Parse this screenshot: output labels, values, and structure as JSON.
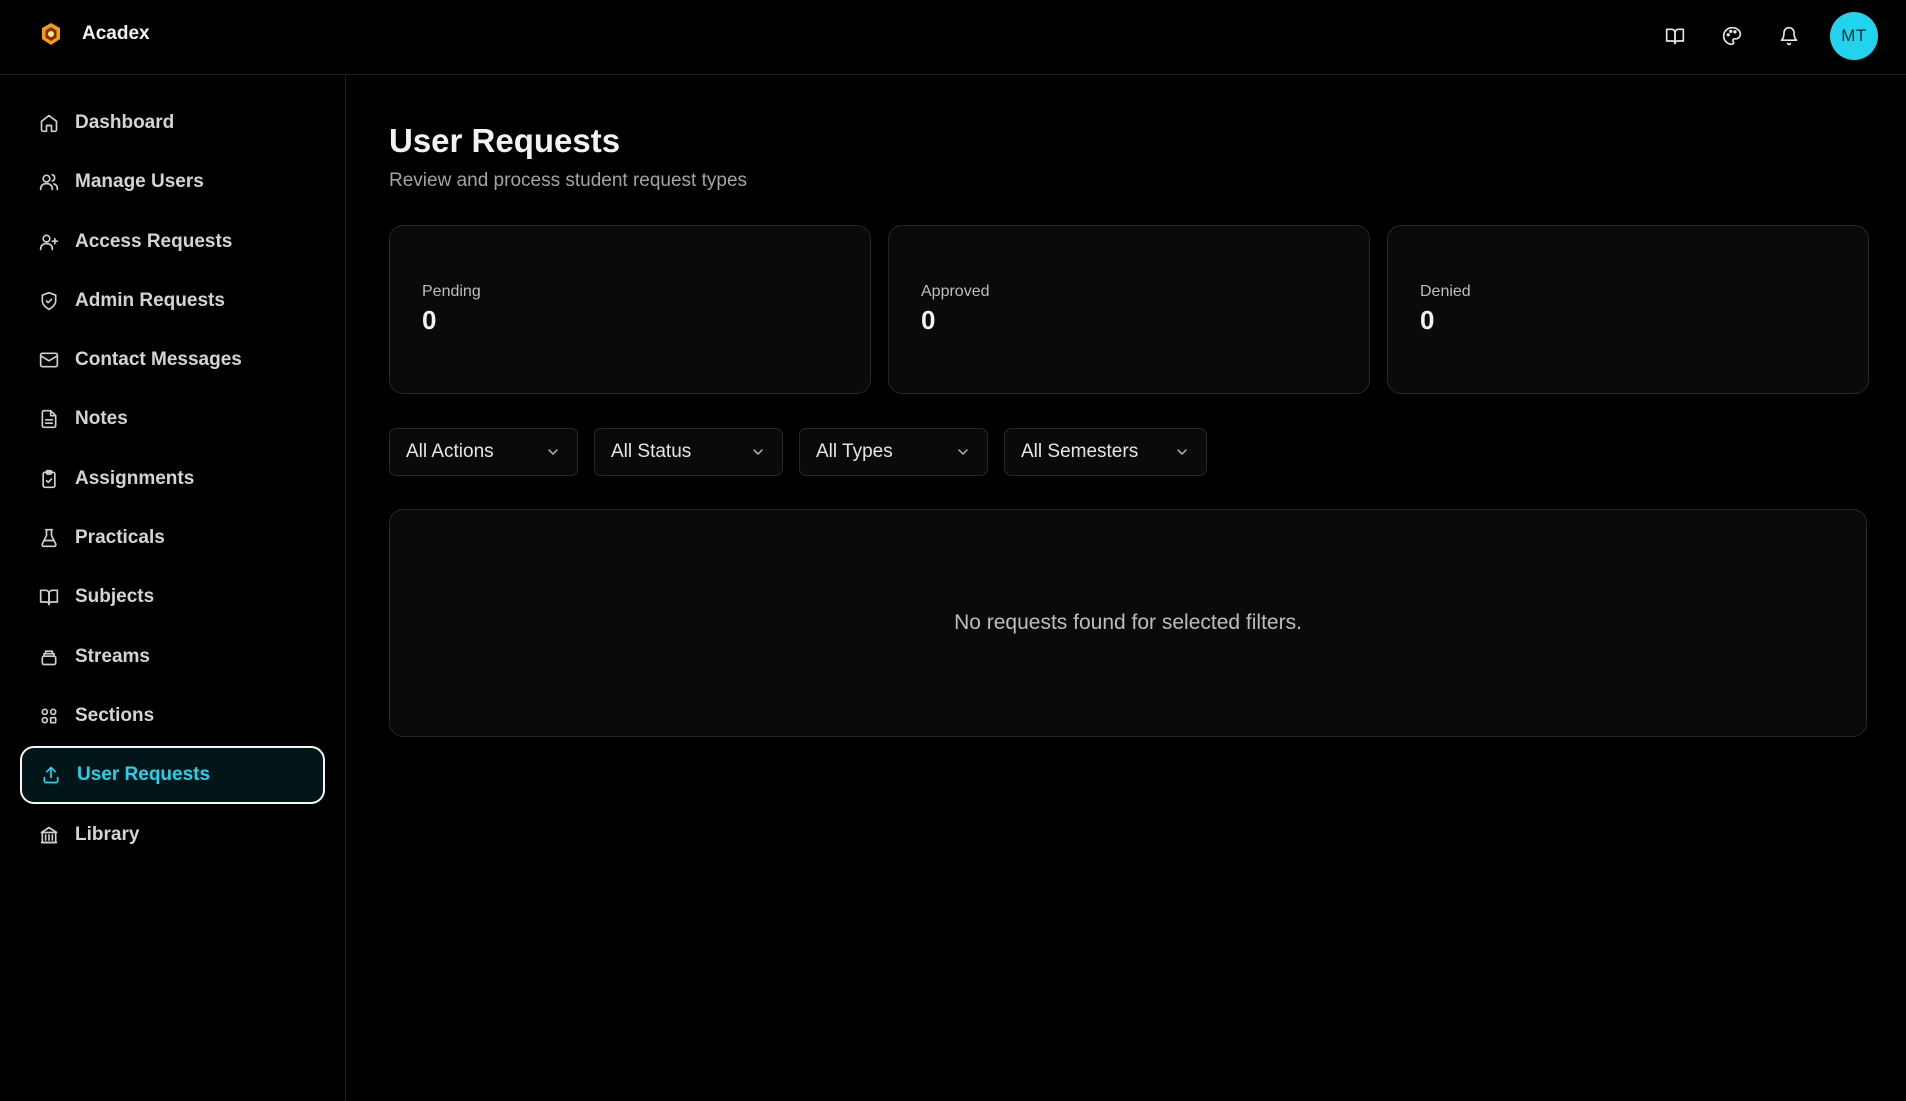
{
  "app": {
    "name": "Acadex"
  },
  "header": {
    "icons": [
      "book-open-icon",
      "palette-icon",
      "bell-icon"
    ],
    "avatar_initials": "MT"
  },
  "sidebar": {
    "items": [
      {
        "label": "Dashboard",
        "icon": "home-icon"
      },
      {
        "label": "Manage Users",
        "icon": "users-icon"
      },
      {
        "label": "Access Requests",
        "icon": "user-plus-icon"
      },
      {
        "label": "Admin Requests",
        "icon": "shield-check-icon"
      },
      {
        "label": "Contact Messages",
        "icon": "mail-icon"
      },
      {
        "label": "Notes",
        "icon": "file-text-icon"
      },
      {
        "label": "Assignments",
        "icon": "clipboard-check-icon"
      },
      {
        "label": "Practicals",
        "icon": "flask-icon"
      },
      {
        "label": "Subjects",
        "icon": "book-open-icon"
      },
      {
        "label": "Streams",
        "icon": "layers-icon"
      },
      {
        "label": "Sections",
        "icon": "grid-icon"
      },
      {
        "label": "User Requests",
        "icon": "upload-icon",
        "active": true
      },
      {
        "label": "Library",
        "icon": "library-icon"
      }
    ]
  },
  "page": {
    "title": "User Requests",
    "subtitle": "Review and process student request types"
  },
  "stats": [
    {
      "label": "Pending",
      "value": "0"
    },
    {
      "label": "Approved",
      "value": "0"
    },
    {
      "label": "Denied",
      "value": "0"
    }
  ],
  "filters": [
    {
      "value": "All Actions"
    },
    {
      "value": "All Status"
    },
    {
      "value": "All Types"
    },
    {
      "value": "All Semesters"
    }
  ],
  "empty_state": {
    "message": "No requests found for selected filters."
  },
  "colors": {
    "accent": "#22d3ee",
    "background": "#000000",
    "card": "#0a0a0a",
    "border": "#262626",
    "active_bg": "#021519"
  }
}
